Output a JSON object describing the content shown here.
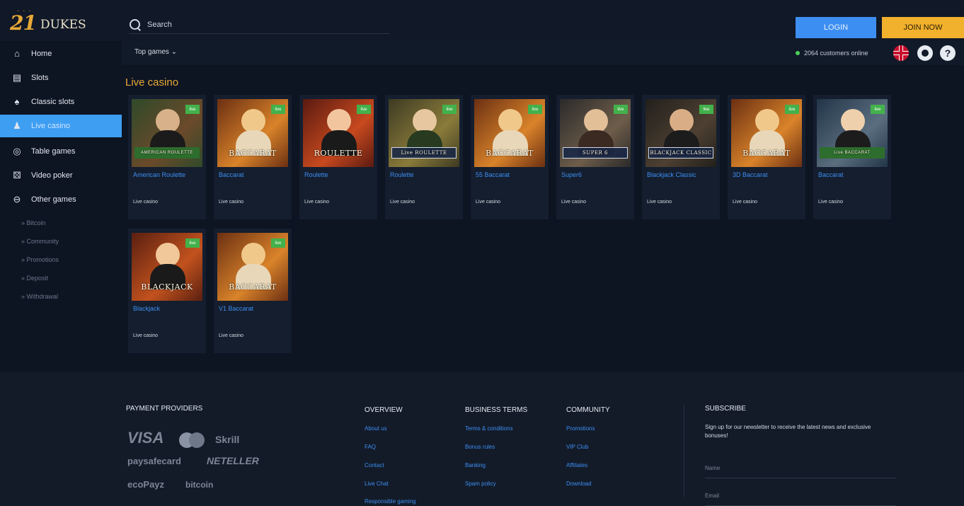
{
  "header": {
    "logo_number": "21",
    "logo_text": "DUKES",
    "search_placeholder": "Search",
    "login_label": "LOGIN",
    "join_label": "JOIN NOW"
  },
  "sidebar": {
    "items": [
      {
        "label": "Home",
        "icon": "home-icon"
      },
      {
        "label": "Slots",
        "icon": "slot-machine-icon"
      },
      {
        "label": "Classic slots",
        "icon": "cards-icon"
      },
      {
        "label": "Live casino",
        "icon": "dealer-icon"
      },
      {
        "label": "Table games",
        "icon": "chips-icon"
      },
      {
        "label": "Video poker",
        "icon": "dice-icon"
      },
      {
        "label": "Other games",
        "icon": "circle-minus-icon"
      }
    ],
    "sub_items": [
      "» Bitcoin",
      "» Community",
      "» Promotions",
      "» Deposit",
      "» Withdrawal"
    ]
  },
  "subbar": {
    "dropdown_label": "Top games  ⌄",
    "online_text": "2064 customers online"
  },
  "content": {
    "section_title": "Live casino",
    "games": [
      {
        "title": "American Roulette",
        "category": "Live casino",
        "label": "AMERICAN ROULETTE",
        "live": "live"
      },
      {
        "title": "Baccarat",
        "category": "Live casino",
        "label": "BACCARAT",
        "live": "live"
      },
      {
        "title": "Roulette",
        "category": "Live casino",
        "label": "ROULETTE",
        "live": "live"
      },
      {
        "title": "Roulette",
        "category": "Live casino",
        "label": "Live ROULETTE",
        "live": "live"
      },
      {
        "title": "55 Baccarat",
        "category": "Live casino",
        "label": "BACCARAT",
        "live": "live"
      },
      {
        "title": "Super6",
        "category": "Live casino",
        "label": "SUPER 6",
        "live": "live"
      },
      {
        "title": "Blackjack Classic",
        "category": "Live casino",
        "label": "BLACKJACK CLASSIC",
        "live": "live"
      },
      {
        "title": "3D Baccarat",
        "category": "Live casino",
        "label": "BACCARAT",
        "live": "live"
      },
      {
        "title": "Baccarat",
        "category": "Live casino",
        "label": "Live BACCARAT",
        "live": "live"
      },
      {
        "title": "Blackjack",
        "category": "Live casino",
        "label": "BLACKJACK",
        "live": "live"
      },
      {
        "title": "V1 Baccarat",
        "category": "Live casino",
        "label": "BACCARAT",
        "live": "live"
      }
    ]
  },
  "footer": {
    "payment_heading": "PAYMENT PROVIDERS",
    "payments": [
      "VISA",
      "Skrill",
      "paysafecard",
      "NETELLER",
      "ecoPayz",
      "bitcoin"
    ],
    "overview": {
      "heading": "OVERVIEW",
      "links": [
        "About us",
        "FAQ",
        "Contact",
        "Live Chat",
        "Responsible gaming"
      ]
    },
    "business": {
      "heading": "BUSINESS TERMS",
      "links": [
        "Terms & conditions",
        "Bonus rules",
        "Banking",
        "Spam policy"
      ]
    },
    "community": {
      "heading": "COMMUNITY",
      "links": [
        "Promotions",
        "VIP Club",
        "Affiliates",
        "Download"
      ]
    },
    "subscribe": {
      "heading": "SUBSCRIBE",
      "text": "Sign up for our newsletter to receive the latest news and exclusive bonuses!",
      "name_placeholder": "Name",
      "email_placeholder": "Email"
    }
  },
  "colors": {
    "accent_blue": "#3d8ef2",
    "accent_gold": "#f2b12d",
    "live_green": "#43b14b"
  }
}
